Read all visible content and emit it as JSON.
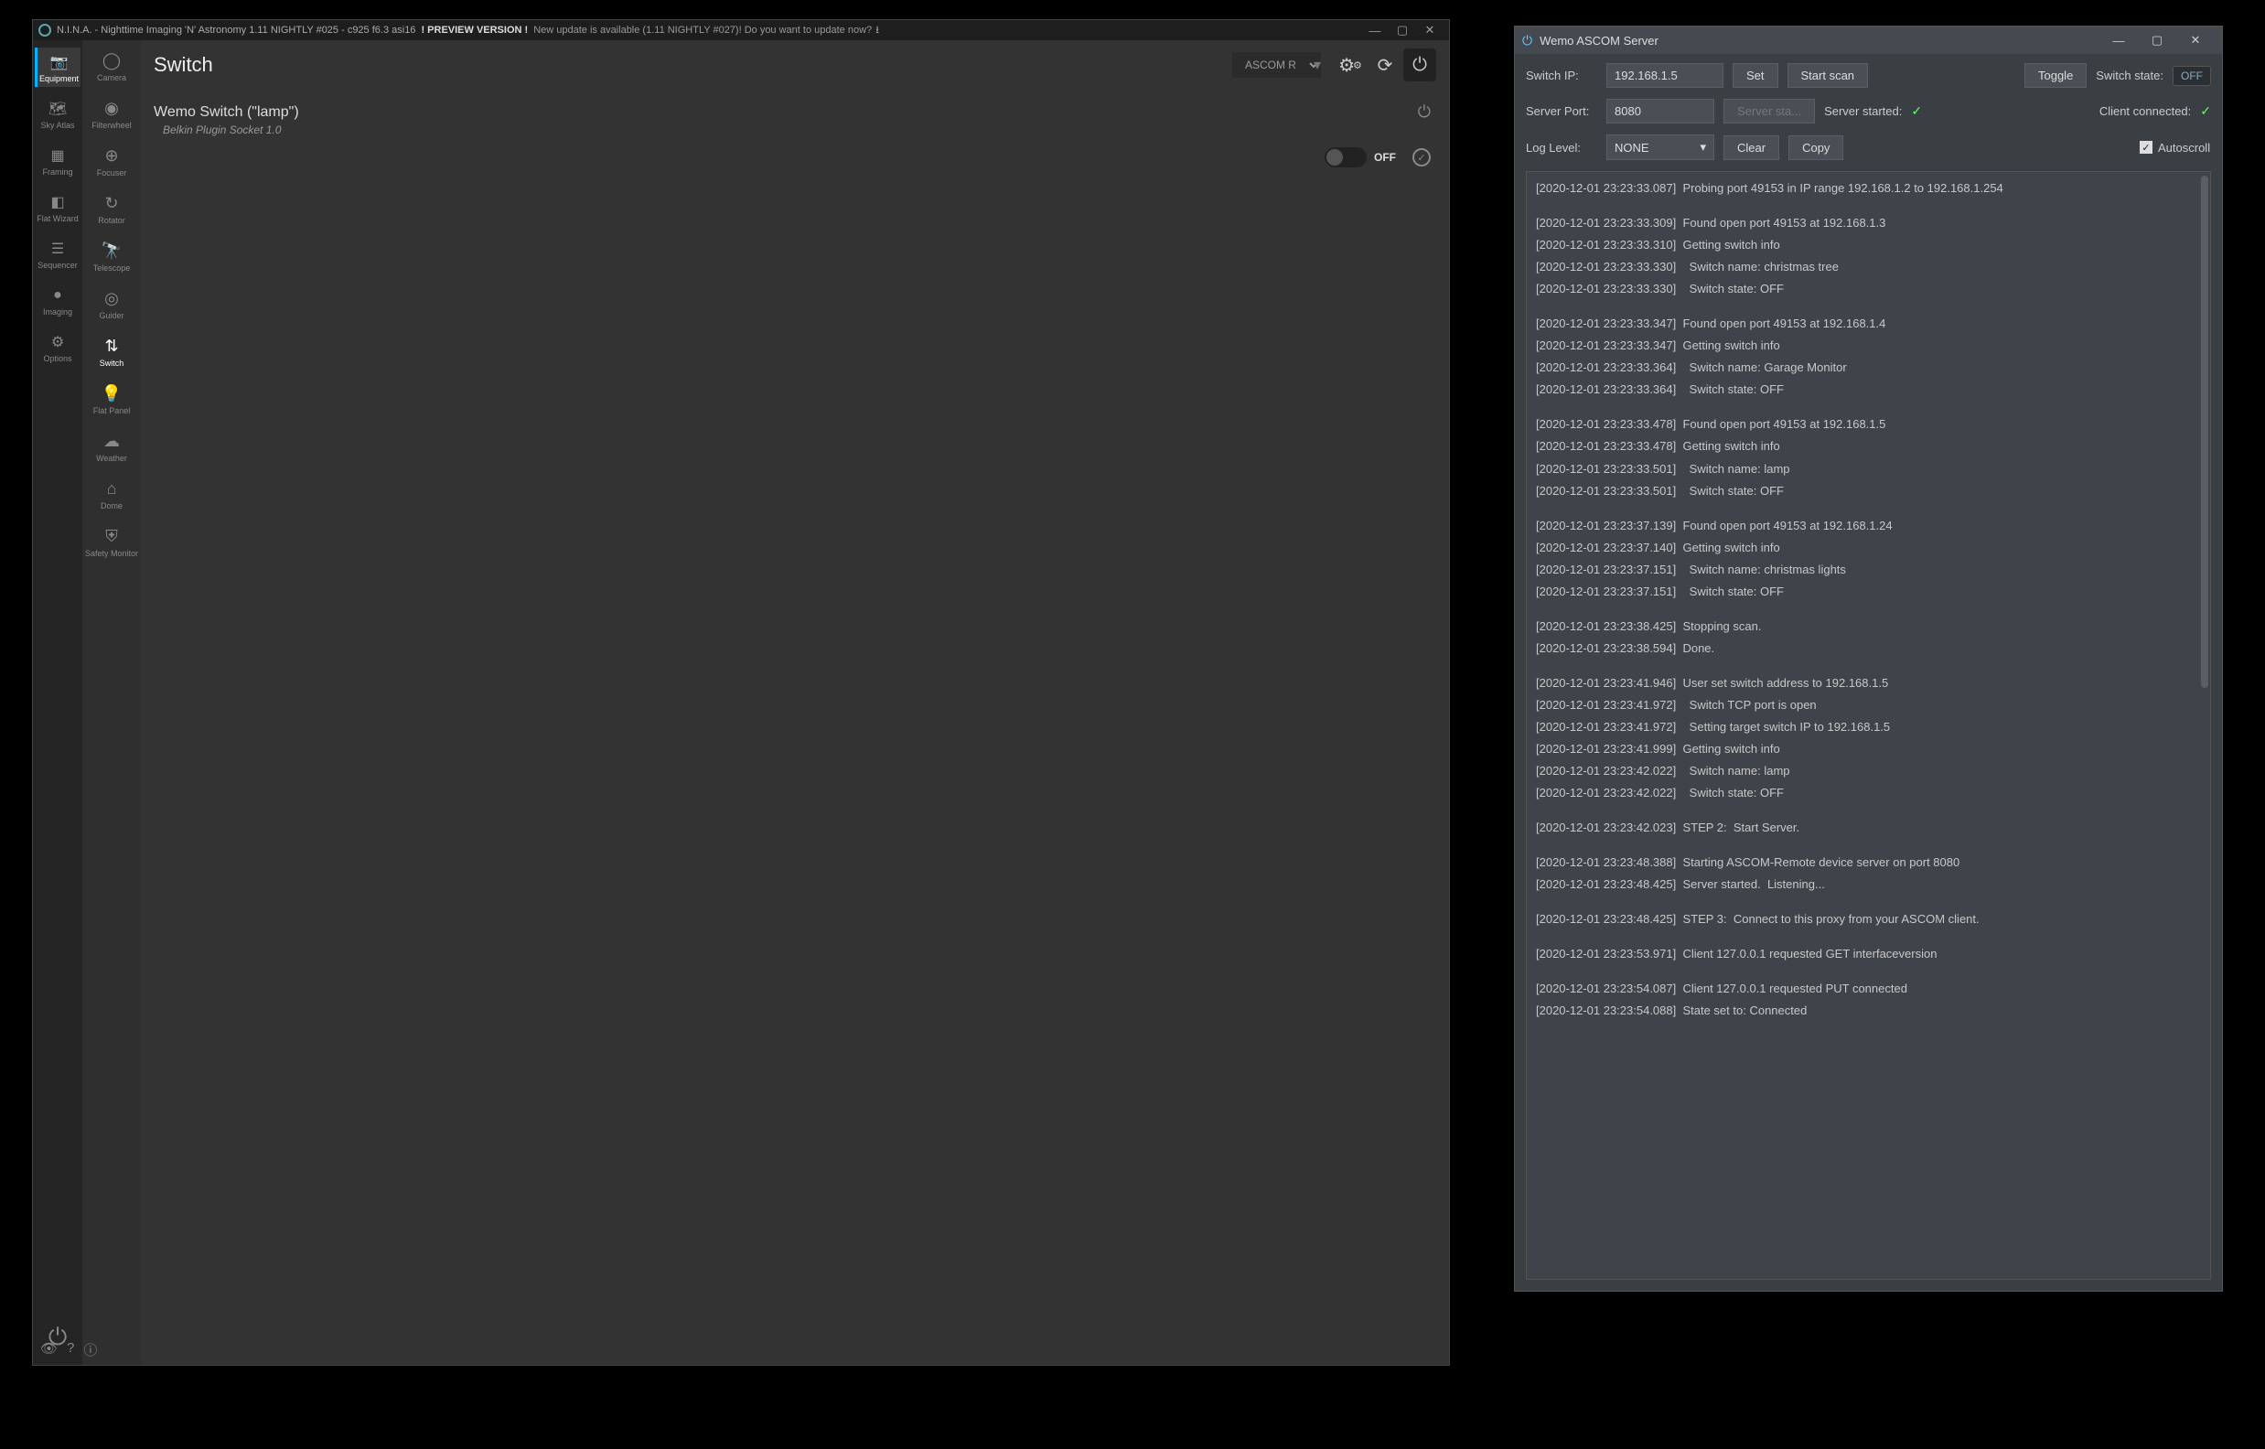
{
  "nina": {
    "title": "N.I.N.A. - Nighttime Imaging 'N' Astronomy 1.11 NIGHTLY #025  -  c925 f6.3 asi16",
    "preview": "! PREVIEW VERSION !",
    "update": "New update is available (1.11 NIGHTLY #027)! Do you want to update now?",
    "nav": [
      {
        "label": "Equipment",
        "icon": "camera-icon",
        "active": true
      },
      {
        "label": "Sky Atlas",
        "icon": "atlas-icon"
      },
      {
        "label": "Framing",
        "icon": "framing-icon"
      },
      {
        "label": "Flat Wizard",
        "icon": "flat-wizard-icon"
      },
      {
        "label": "Sequencer",
        "icon": "sequencer-icon"
      },
      {
        "label": "Imaging",
        "icon": "imaging-icon"
      },
      {
        "label": "Options",
        "icon": "gear-icon"
      }
    ],
    "equipment": [
      {
        "label": "Camera",
        "icon": "aperture-icon"
      },
      {
        "label": "Filterwheel",
        "icon": "filterwheel-icon"
      },
      {
        "label": "Focuser",
        "icon": "focuser-icon"
      },
      {
        "label": "Rotator",
        "icon": "rotator-icon"
      },
      {
        "label": "Telescope",
        "icon": "telescope-icon"
      },
      {
        "label": "Guider",
        "icon": "guider-icon"
      },
      {
        "label": "Switch",
        "icon": "switch-sliders-icon",
        "active": true
      },
      {
        "label": "Flat Panel",
        "icon": "bulb-icon"
      },
      {
        "label": "Weather",
        "icon": "cloud-icon"
      },
      {
        "label": "Dome",
        "icon": "dome-icon"
      },
      {
        "label": "Safety Monitor",
        "icon": "shield-icon"
      }
    ],
    "page_title": "Switch",
    "device_selected": "ASCOM R",
    "switch_card": {
      "title": "Wemo Switch (\"lamp\")",
      "subtitle": "Belkin Plugin Socket 1.0",
      "state_label": "OFF"
    }
  },
  "wemo": {
    "title": "Wemo ASCOM Server",
    "row1": {
      "ip_label": "Switch IP:",
      "ip_value": "192.168.1.5",
      "set_btn": "Set",
      "scan_btn": "Start scan",
      "toggle_btn": "Toggle",
      "state_label": "Switch state:",
      "state_value": "OFF"
    },
    "row2": {
      "port_label": "Server Port:",
      "port_value": "8080",
      "start_btn": "Server sta...",
      "started_label": "Server started:",
      "client_label": "Client connected:"
    },
    "row3": {
      "log_label": "Log Level:",
      "log_value": "NONE",
      "clear_btn": "Clear",
      "copy_btn": "Copy",
      "autoscroll": "Autoscroll"
    },
    "log": [
      [
        "[2020-12-01 23:23:33.087]  Probing port 49153 in IP range 192.168.1.2 to 192.168.1.254"
      ],
      [
        "[2020-12-01 23:23:33.309]  Found open port 49153 at 192.168.1.3",
        "[2020-12-01 23:23:33.310]  Getting switch info",
        "[2020-12-01 23:23:33.330]    Switch name: christmas tree",
        "[2020-12-01 23:23:33.330]    Switch state: OFF"
      ],
      [
        "[2020-12-01 23:23:33.347]  Found open port 49153 at 192.168.1.4",
        "[2020-12-01 23:23:33.347]  Getting switch info",
        "[2020-12-01 23:23:33.364]    Switch name: Garage Monitor",
        "[2020-12-01 23:23:33.364]    Switch state: OFF"
      ],
      [
        "[2020-12-01 23:23:33.478]  Found open port 49153 at 192.168.1.5",
        "[2020-12-01 23:23:33.478]  Getting switch info",
        "[2020-12-01 23:23:33.501]    Switch name: lamp",
        "[2020-12-01 23:23:33.501]    Switch state: OFF"
      ],
      [
        "[2020-12-01 23:23:37.139]  Found open port 49153 at 192.168.1.24",
        "[2020-12-01 23:23:37.140]  Getting switch info",
        "[2020-12-01 23:23:37.151]    Switch name: christmas lights",
        "[2020-12-01 23:23:37.151]    Switch state: OFF"
      ],
      [
        "[2020-12-01 23:23:38.425]  Stopping scan.",
        "[2020-12-01 23:23:38.594]  Done."
      ],
      [
        "[2020-12-01 23:23:41.946]  User set switch address to 192.168.1.5",
        "[2020-12-01 23:23:41.972]    Switch TCP port is open",
        "[2020-12-01 23:23:41.972]    Setting target switch IP to 192.168.1.5",
        "[2020-12-01 23:23:41.999]  Getting switch info",
        "[2020-12-01 23:23:42.022]    Switch name: lamp",
        "[2020-12-01 23:23:42.022]    Switch state: OFF"
      ],
      [
        "[2020-12-01 23:23:42.023]  STEP 2:  Start Server."
      ],
      [
        "[2020-12-01 23:23:48.388]  Starting ASCOM-Remote device server on port 8080",
        "[2020-12-01 23:23:48.425]  Server started.  Listening..."
      ],
      [
        "[2020-12-01 23:23:48.425]  STEP 3:  Connect to this proxy from your ASCOM client."
      ],
      [
        ""
      ],
      [
        "[2020-12-01 23:23:53.971]  Client 127.0.0.1 requested GET interfaceversion"
      ],
      [
        "[2020-12-01 23:23:54.087]  Client 127.0.0.1 requested PUT connected",
        "[2020-12-01 23:23:54.088]  State set to: Connected"
      ]
    ]
  }
}
